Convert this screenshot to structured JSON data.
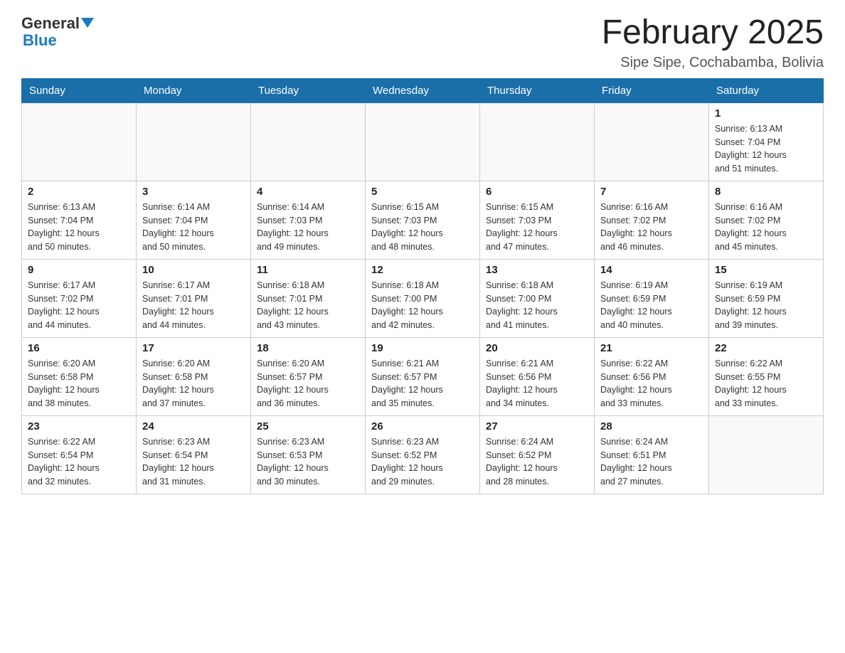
{
  "header": {
    "logo_general": "General",
    "logo_blue": "Blue",
    "title": "February 2025",
    "location": "Sipe Sipe, Cochabamba, Bolivia"
  },
  "weekdays": [
    "Sunday",
    "Monday",
    "Tuesday",
    "Wednesday",
    "Thursday",
    "Friday",
    "Saturday"
  ],
  "weeks": [
    [
      {
        "day": "",
        "info": ""
      },
      {
        "day": "",
        "info": ""
      },
      {
        "day": "",
        "info": ""
      },
      {
        "day": "",
        "info": ""
      },
      {
        "day": "",
        "info": ""
      },
      {
        "day": "",
        "info": ""
      },
      {
        "day": "1",
        "info": "Sunrise: 6:13 AM\nSunset: 7:04 PM\nDaylight: 12 hours\nand 51 minutes."
      }
    ],
    [
      {
        "day": "2",
        "info": "Sunrise: 6:13 AM\nSunset: 7:04 PM\nDaylight: 12 hours\nand 50 minutes."
      },
      {
        "day": "3",
        "info": "Sunrise: 6:14 AM\nSunset: 7:04 PM\nDaylight: 12 hours\nand 50 minutes."
      },
      {
        "day": "4",
        "info": "Sunrise: 6:14 AM\nSunset: 7:03 PM\nDaylight: 12 hours\nand 49 minutes."
      },
      {
        "day": "5",
        "info": "Sunrise: 6:15 AM\nSunset: 7:03 PM\nDaylight: 12 hours\nand 48 minutes."
      },
      {
        "day": "6",
        "info": "Sunrise: 6:15 AM\nSunset: 7:03 PM\nDaylight: 12 hours\nand 47 minutes."
      },
      {
        "day": "7",
        "info": "Sunrise: 6:16 AM\nSunset: 7:02 PM\nDaylight: 12 hours\nand 46 minutes."
      },
      {
        "day": "8",
        "info": "Sunrise: 6:16 AM\nSunset: 7:02 PM\nDaylight: 12 hours\nand 45 minutes."
      }
    ],
    [
      {
        "day": "9",
        "info": "Sunrise: 6:17 AM\nSunset: 7:02 PM\nDaylight: 12 hours\nand 44 minutes."
      },
      {
        "day": "10",
        "info": "Sunrise: 6:17 AM\nSunset: 7:01 PM\nDaylight: 12 hours\nand 44 minutes."
      },
      {
        "day": "11",
        "info": "Sunrise: 6:18 AM\nSunset: 7:01 PM\nDaylight: 12 hours\nand 43 minutes."
      },
      {
        "day": "12",
        "info": "Sunrise: 6:18 AM\nSunset: 7:00 PM\nDaylight: 12 hours\nand 42 minutes."
      },
      {
        "day": "13",
        "info": "Sunrise: 6:18 AM\nSunset: 7:00 PM\nDaylight: 12 hours\nand 41 minutes."
      },
      {
        "day": "14",
        "info": "Sunrise: 6:19 AM\nSunset: 6:59 PM\nDaylight: 12 hours\nand 40 minutes."
      },
      {
        "day": "15",
        "info": "Sunrise: 6:19 AM\nSunset: 6:59 PM\nDaylight: 12 hours\nand 39 minutes."
      }
    ],
    [
      {
        "day": "16",
        "info": "Sunrise: 6:20 AM\nSunset: 6:58 PM\nDaylight: 12 hours\nand 38 minutes."
      },
      {
        "day": "17",
        "info": "Sunrise: 6:20 AM\nSunset: 6:58 PM\nDaylight: 12 hours\nand 37 minutes."
      },
      {
        "day": "18",
        "info": "Sunrise: 6:20 AM\nSunset: 6:57 PM\nDaylight: 12 hours\nand 36 minutes."
      },
      {
        "day": "19",
        "info": "Sunrise: 6:21 AM\nSunset: 6:57 PM\nDaylight: 12 hours\nand 35 minutes."
      },
      {
        "day": "20",
        "info": "Sunrise: 6:21 AM\nSunset: 6:56 PM\nDaylight: 12 hours\nand 34 minutes."
      },
      {
        "day": "21",
        "info": "Sunrise: 6:22 AM\nSunset: 6:56 PM\nDaylight: 12 hours\nand 33 minutes."
      },
      {
        "day": "22",
        "info": "Sunrise: 6:22 AM\nSunset: 6:55 PM\nDaylight: 12 hours\nand 33 minutes."
      }
    ],
    [
      {
        "day": "23",
        "info": "Sunrise: 6:22 AM\nSunset: 6:54 PM\nDaylight: 12 hours\nand 32 minutes."
      },
      {
        "day": "24",
        "info": "Sunrise: 6:23 AM\nSunset: 6:54 PM\nDaylight: 12 hours\nand 31 minutes."
      },
      {
        "day": "25",
        "info": "Sunrise: 6:23 AM\nSunset: 6:53 PM\nDaylight: 12 hours\nand 30 minutes."
      },
      {
        "day": "26",
        "info": "Sunrise: 6:23 AM\nSunset: 6:52 PM\nDaylight: 12 hours\nand 29 minutes."
      },
      {
        "day": "27",
        "info": "Sunrise: 6:24 AM\nSunset: 6:52 PM\nDaylight: 12 hours\nand 28 minutes."
      },
      {
        "day": "28",
        "info": "Sunrise: 6:24 AM\nSunset: 6:51 PM\nDaylight: 12 hours\nand 27 minutes."
      },
      {
        "day": "",
        "info": ""
      }
    ]
  ]
}
